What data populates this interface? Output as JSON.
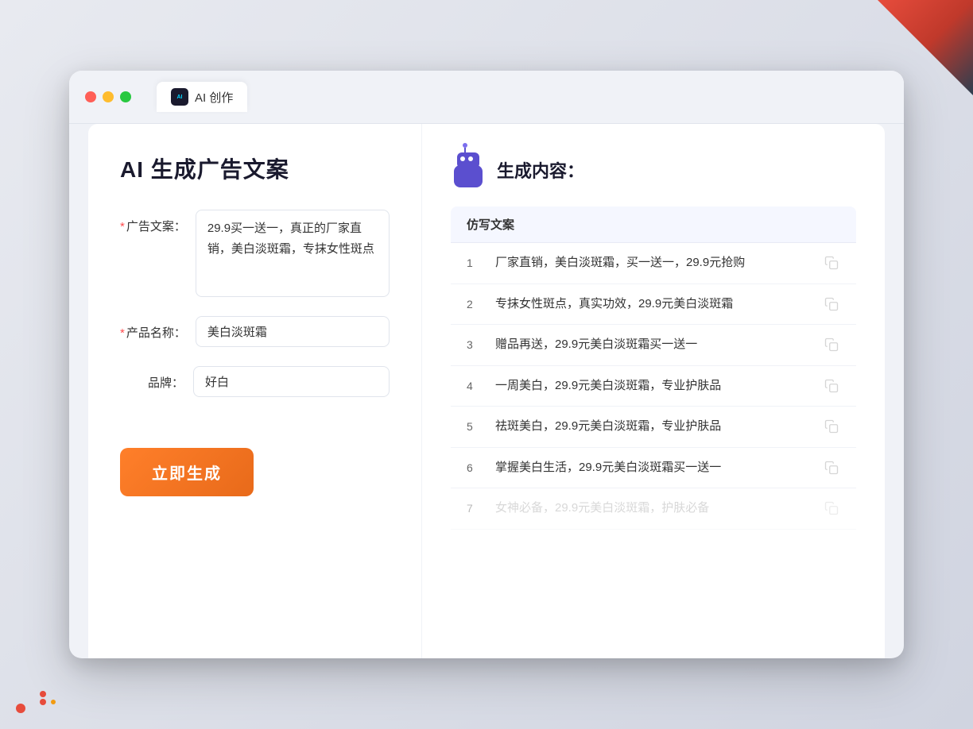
{
  "browser": {
    "tab_label": "AI 创作",
    "traffic_lights": [
      "red",
      "yellow",
      "green"
    ]
  },
  "left_panel": {
    "page_title": "AI 生成广告文案",
    "form": {
      "ad_copy_label": "广告文案：",
      "ad_copy_required": "*",
      "ad_copy_value": "29.9买一送一，真正的厂家直销，美白淡斑霜，专抹女性斑点",
      "product_name_label": "产品名称：",
      "product_name_required": "*",
      "product_name_value": "美白淡斑霜",
      "brand_label": "品牌：",
      "brand_value": "好白"
    },
    "generate_button": "立即生成"
  },
  "right_panel": {
    "result_title": "生成内容：",
    "table_header": "仿写文案",
    "results": [
      {
        "number": "1",
        "content": "厂家直销，美白淡斑霜，买一送一，29.9元抢购",
        "dimmed": false
      },
      {
        "number": "2",
        "content": "专抹女性斑点，真实功效，29.9元美白淡斑霜",
        "dimmed": false
      },
      {
        "number": "3",
        "content": "赠品再送，29.9元美白淡斑霜买一送一",
        "dimmed": false
      },
      {
        "number": "4",
        "content": "一周美白，29.9元美白淡斑霜，专业护肤品",
        "dimmed": false
      },
      {
        "number": "5",
        "content": "祛斑美白，29.9元美白淡斑霜，专业护肤品",
        "dimmed": false
      },
      {
        "number": "6",
        "content": "掌握美白生活，29.9元美白淡斑霜买一送一",
        "dimmed": false
      },
      {
        "number": "7",
        "content": "女神必备，29.9元美白淡斑霜，护肤必备",
        "dimmed": true
      }
    ]
  }
}
